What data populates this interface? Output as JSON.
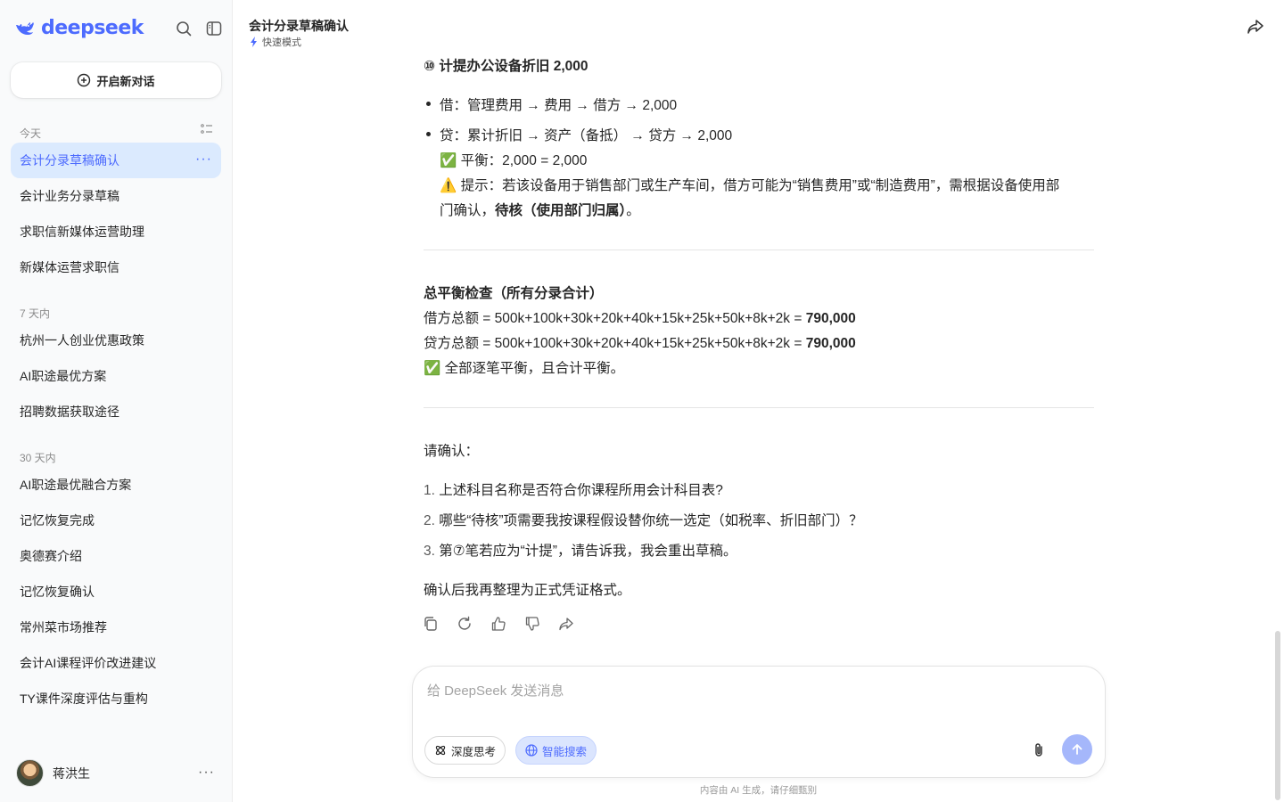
{
  "brand": {
    "name": "deepseek",
    "accent": "#4d6bfe"
  },
  "sidebar": {
    "new_chat_label": "开启新对话",
    "groups": [
      {
        "label": "今天",
        "items": [
          "会计分录草稿确认",
          "会计业务分录草稿",
          "求职信新媒体运营助理",
          "新媒体运营求职信"
        ]
      },
      {
        "label": "7 天内",
        "items": [
          "杭州一人创业优惠政策",
          "AI职途最优方案",
          "招聘数据获取途径"
        ]
      },
      {
        "label": "30 天内",
        "items": [
          "AI职途最优融合方案",
          "记忆恢复完成",
          "奥德赛介绍",
          "记忆恢复确认",
          "常州菜市场推荐",
          "会计AI课程评价改进建议",
          "TY课件深度评估与重构"
        ]
      }
    ],
    "active_item": "会计分录草稿确认",
    "more_glyph": "···",
    "user": {
      "name": "蒋洪生"
    }
  },
  "header": {
    "title": "会计分录草稿确认",
    "mode": "快速模式"
  },
  "message": {
    "entry10_title": "⑩ 计提办公设备折旧 2,000",
    "debit": "借：管理费用 → 费用 → 借方 → 2,000",
    "credit": "贷：累计折旧 → 资产（备抵） → 贷方 → 2,000",
    "balance_icon": "✅",
    "balance": "平衡：2,000 = 2,000",
    "warn_icon": "⚠️",
    "warn_line1": "提示：若该设备用于销售部门或生产车间，借方可能为“销售费用”或“制造费用”，需根据设备使用部",
    "warn_line2_pre": "门确认，",
    "warn_line2_bold": "待核（使用部门归属）",
    "warn_line2_post": "。",
    "total_title": "总平衡检查（所有分录合计）",
    "total_debit_pre": "借方总额 = 500k+100k+30k+20k+40k+15k+25k+50k+8k+2k = ",
    "total_debit_val": "790,000",
    "total_credit_pre": "贷方总额 = 500k+100k+30k+20k+40k+15k+25k+50k+8k+2k = ",
    "total_credit_val": "790,000",
    "total_ok": "全部逐笔平衡，且合计平衡。",
    "confirm_title": "请确认：",
    "confirm_items": [
      {
        "num": "1.",
        "text": "上述科目名称是否符合你课程所用会计科目表?"
      },
      {
        "num": "2.",
        "text": "哪些“待核”项需要我按课程假设替你统一选定（如税率、折旧部门）？"
      },
      {
        "num": "3.",
        "text": "第⑦笔若应为“计提”，请告诉我，我会重出草稿。"
      }
    ],
    "closing": "确认后我再整理为正式凭证格式。"
  },
  "composer": {
    "placeholder": "给 DeepSeek 发送消息",
    "value": "",
    "deep_think_label": "深度思考",
    "smart_search_label": "智能搜索"
  },
  "footer": {
    "disclaimer": "内容由 AI 生成，请仔细甄别"
  },
  "icons": [
    "deepseek-logo-icon",
    "search-icon",
    "sidebar-toggle-icon",
    "plus-circle-icon",
    "list-icon",
    "lightning-icon",
    "share-icon",
    "copy-icon",
    "regenerate-icon",
    "thumbs-up-icon",
    "thumbs-down-icon",
    "atom-icon",
    "globe-icon",
    "paperclip-icon",
    "arrow-up-icon"
  ]
}
